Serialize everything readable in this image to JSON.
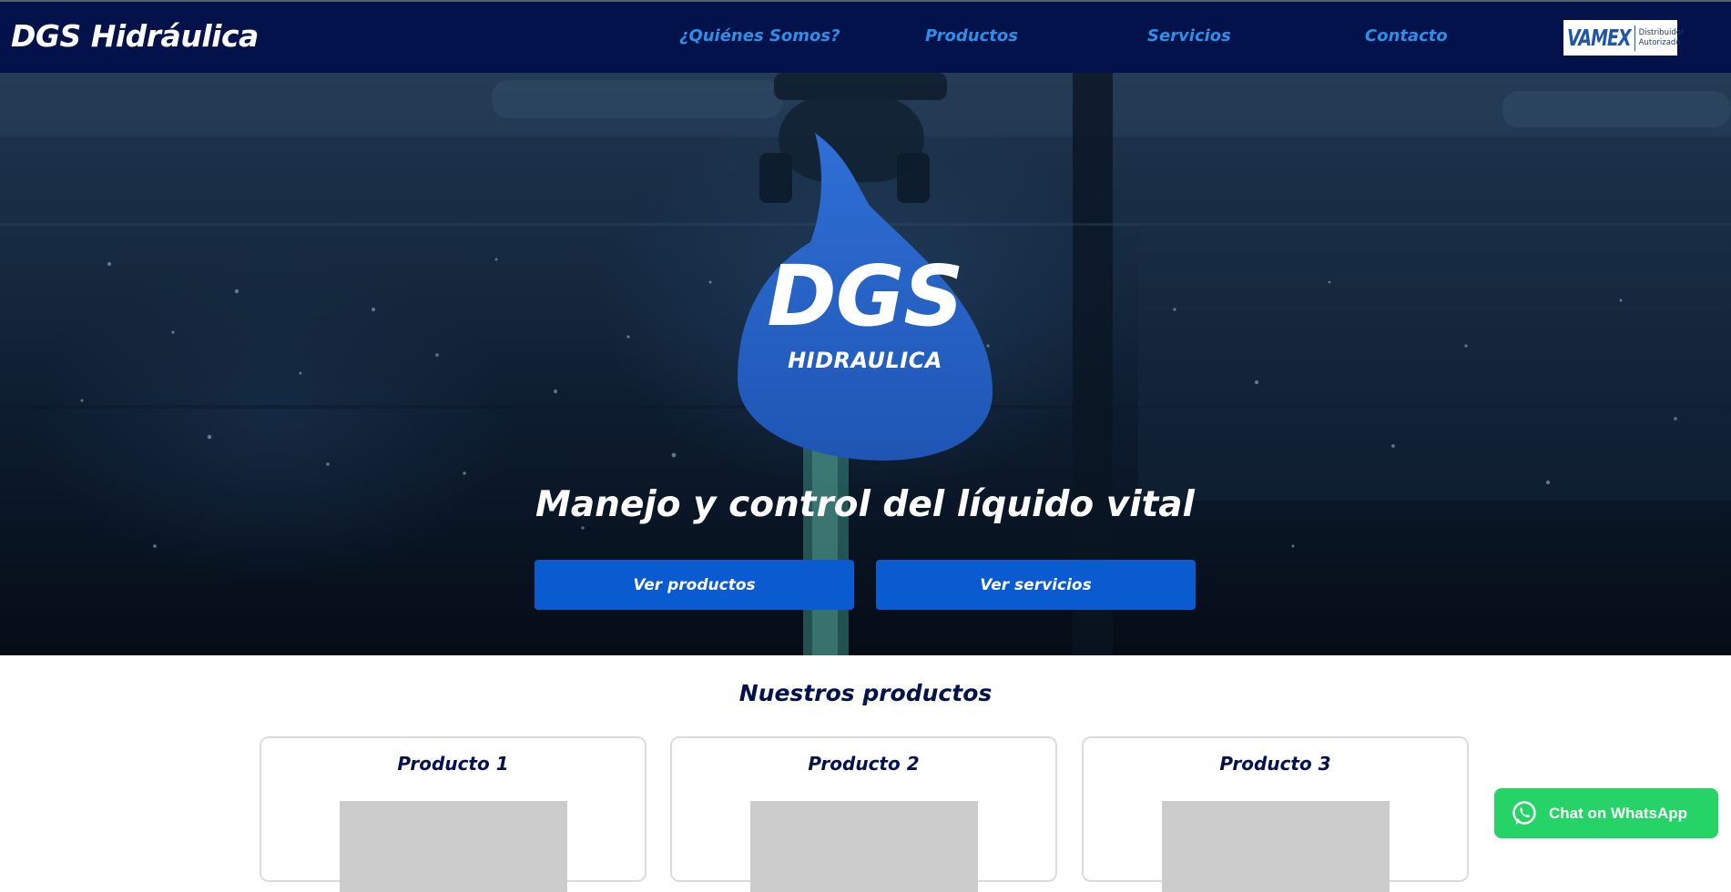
{
  "header": {
    "brand": "DGS Hidráulica",
    "nav": [
      {
        "label": "¿Quiénes Somos?"
      },
      {
        "label": "Productos"
      },
      {
        "label": "Servicios"
      },
      {
        "label": "Contacto"
      }
    ],
    "partner_badge": {
      "brand": "VAMEX",
      "line1": "Distribuidor",
      "line2": "Autorizado"
    }
  },
  "hero": {
    "logo_main": "DGS",
    "logo_sub": "HIDRAULICA",
    "title": "Manejo y control del líquido vital",
    "buttons": [
      {
        "label": "Ver productos"
      },
      {
        "label": "Ver servicios"
      }
    ]
  },
  "products": {
    "title": "Nuestros productos",
    "items": [
      {
        "name": "Producto 1"
      },
      {
        "name": "Producto 2"
      },
      {
        "name": "Producto 3"
      }
    ]
  },
  "whatsapp": {
    "label": "Chat on WhatsApp"
  },
  "colors": {
    "navbar_bg": "#03124a",
    "nav_link": "#2d8fe6",
    "button_blue": "#0a5bd0",
    "drop_blue": "#2563c9",
    "whatsapp_green": "#25d366"
  }
}
